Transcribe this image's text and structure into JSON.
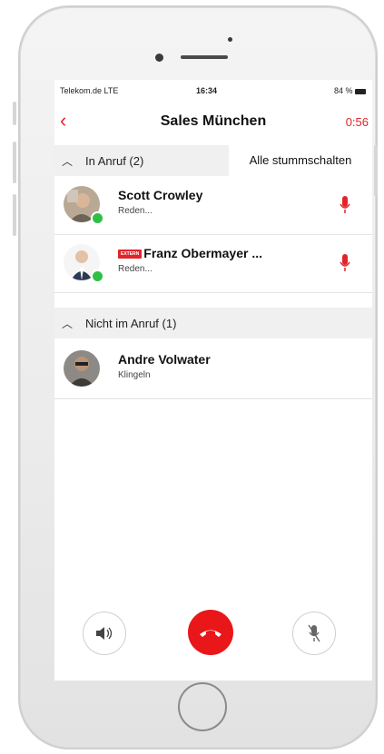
{
  "status_bar": {
    "carrier": "Telekom.de LTE",
    "time": "16:34",
    "battery": "84 %"
  },
  "nav": {
    "back_label": "‹",
    "title": "Sales München",
    "timer": "0:56"
  },
  "section_in_call": {
    "label": "In Anruf (2)",
    "mute_all": "Alle stummschalten"
  },
  "section_not_in_call": {
    "label": "Nicht im Anruf (1)"
  },
  "participants_in_call": [
    {
      "name": "Scott Crowley",
      "status": "Reden..."
    },
    {
      "name": "Franz Obermayer ...",
      "status": "Reden...",
      "badge": "EXTERN"
    }
  ],
  "participants_not_in_call": [
    {
      "name": "Andre Volwater",
      "status": "Klingeln"
    }
  ],
  "icons": {
    "back": "chevron-left-icon",
    "collapse": "chevron-up-icon",
    "mic": "microphone-icon",
    "speaker": "speaker-icon",
    "hangup": "phone-hangup-icon"
  },
  "colors": {
    "accent": "#e0242a",
    "online": "#2fbf45",
    "hangup": "#e9161a"
  }
}
